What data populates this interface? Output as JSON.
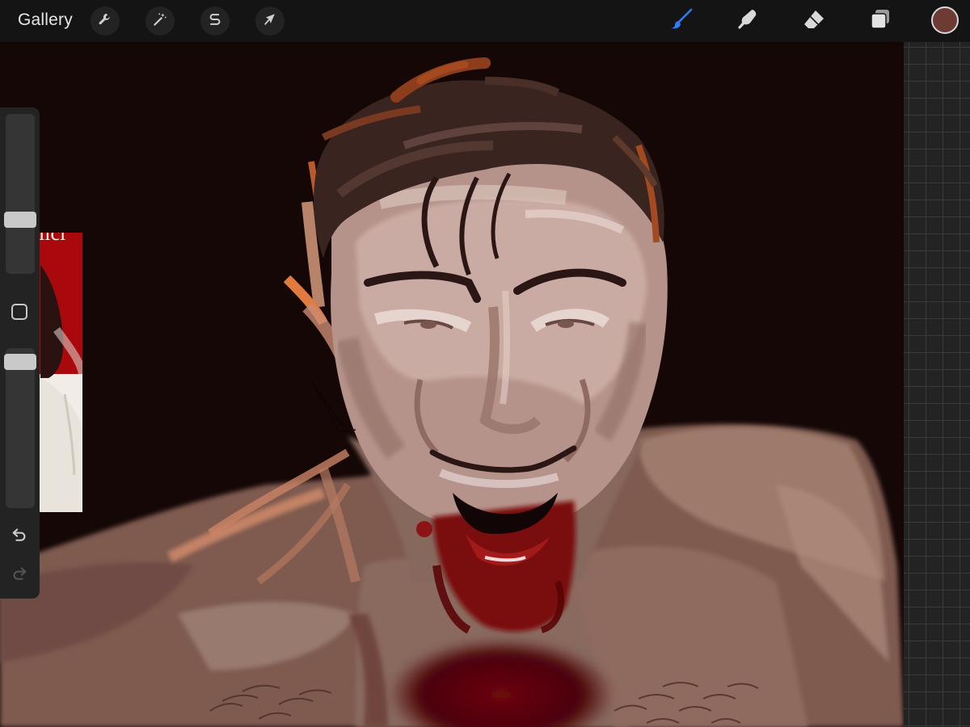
{
  "toolbar": {
    "gallery_label": "Gallery",
    "left_tools": [
      {
        "name": "actions",
        "icon": "wrench-icon"
      },
      {
        "name": "adjustments",
        "icon": "magic-wand-icon"
      },
      {
        "name": "selection",
        "icon": "selection-s-icon"
      },
      {
        "name": "transform",
        "icon": "arrow-cursor-icon"
      }
    ],
    "right_tools": [
      {
        "name": "brush",
        "icon": "brush-icon",
        "active": true
      },
      {
        "name": "smudge",
        "icon": "smudge-finger-icon",
        "active": false
      },
      {
        "name": "eraser",
        "icon": "eraser-icon",
        "active": false
      },
      {
        "name": "layers",
        "icon": "layers-icon",
        "active": false
      }
    ],
    "current_color": "#6e3b34",
    "active_color": "#2f7df6"
  },
  "sidebar": {
    "brush_size_level": 0.32,
    "opacity_level": 0.96,
    "modify_button_icon": "square-icon",
    "undo_icon": "undo-icon",
    "redo_icon": "redo-icon"
  },
  "reference": {
    "title_fragment": "ilcı"
  },
  "colors": {
    "canvas_background": "#140706",
    "toolbar_background": "#141414",
    "sidebar_background": "#232323",
    "skin_tone": "#8c6558",
    "blood_red": "#7a0c0d"
  }
}
